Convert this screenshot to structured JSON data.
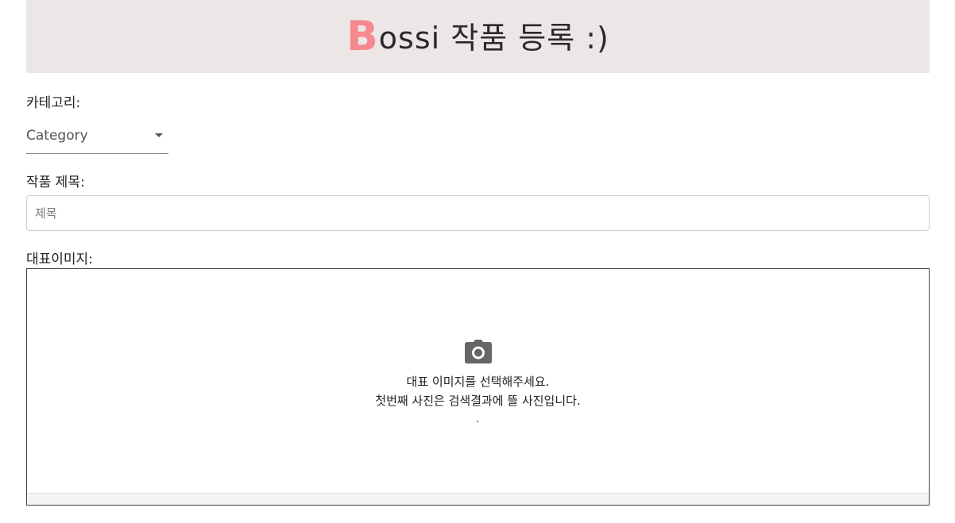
{
  "header": {
    "title_first_letter": "B",
    "title_rest": "ossi 작품 등록 :)",
    "accent_color": "#f6888f",
    "background_color": "#ece6e6"
  },
  "form": {
    "category": {
      "label": "카테고리:",
      "selected_value": "Category"
    },
    "title": {
      "label": "작품 제목:",
      "placeholder": "제목",
      "value": ""
    },
    "main_image": {
      "label": "대표이미지:",
      "icon": "camera-icon",
      "instruction_line1": "대표 이미지를 선택해주세요.",
      "instruction_line2": "첫번째 사진은 검색결과에 뜰 사진입니다."
    }
  }
}
